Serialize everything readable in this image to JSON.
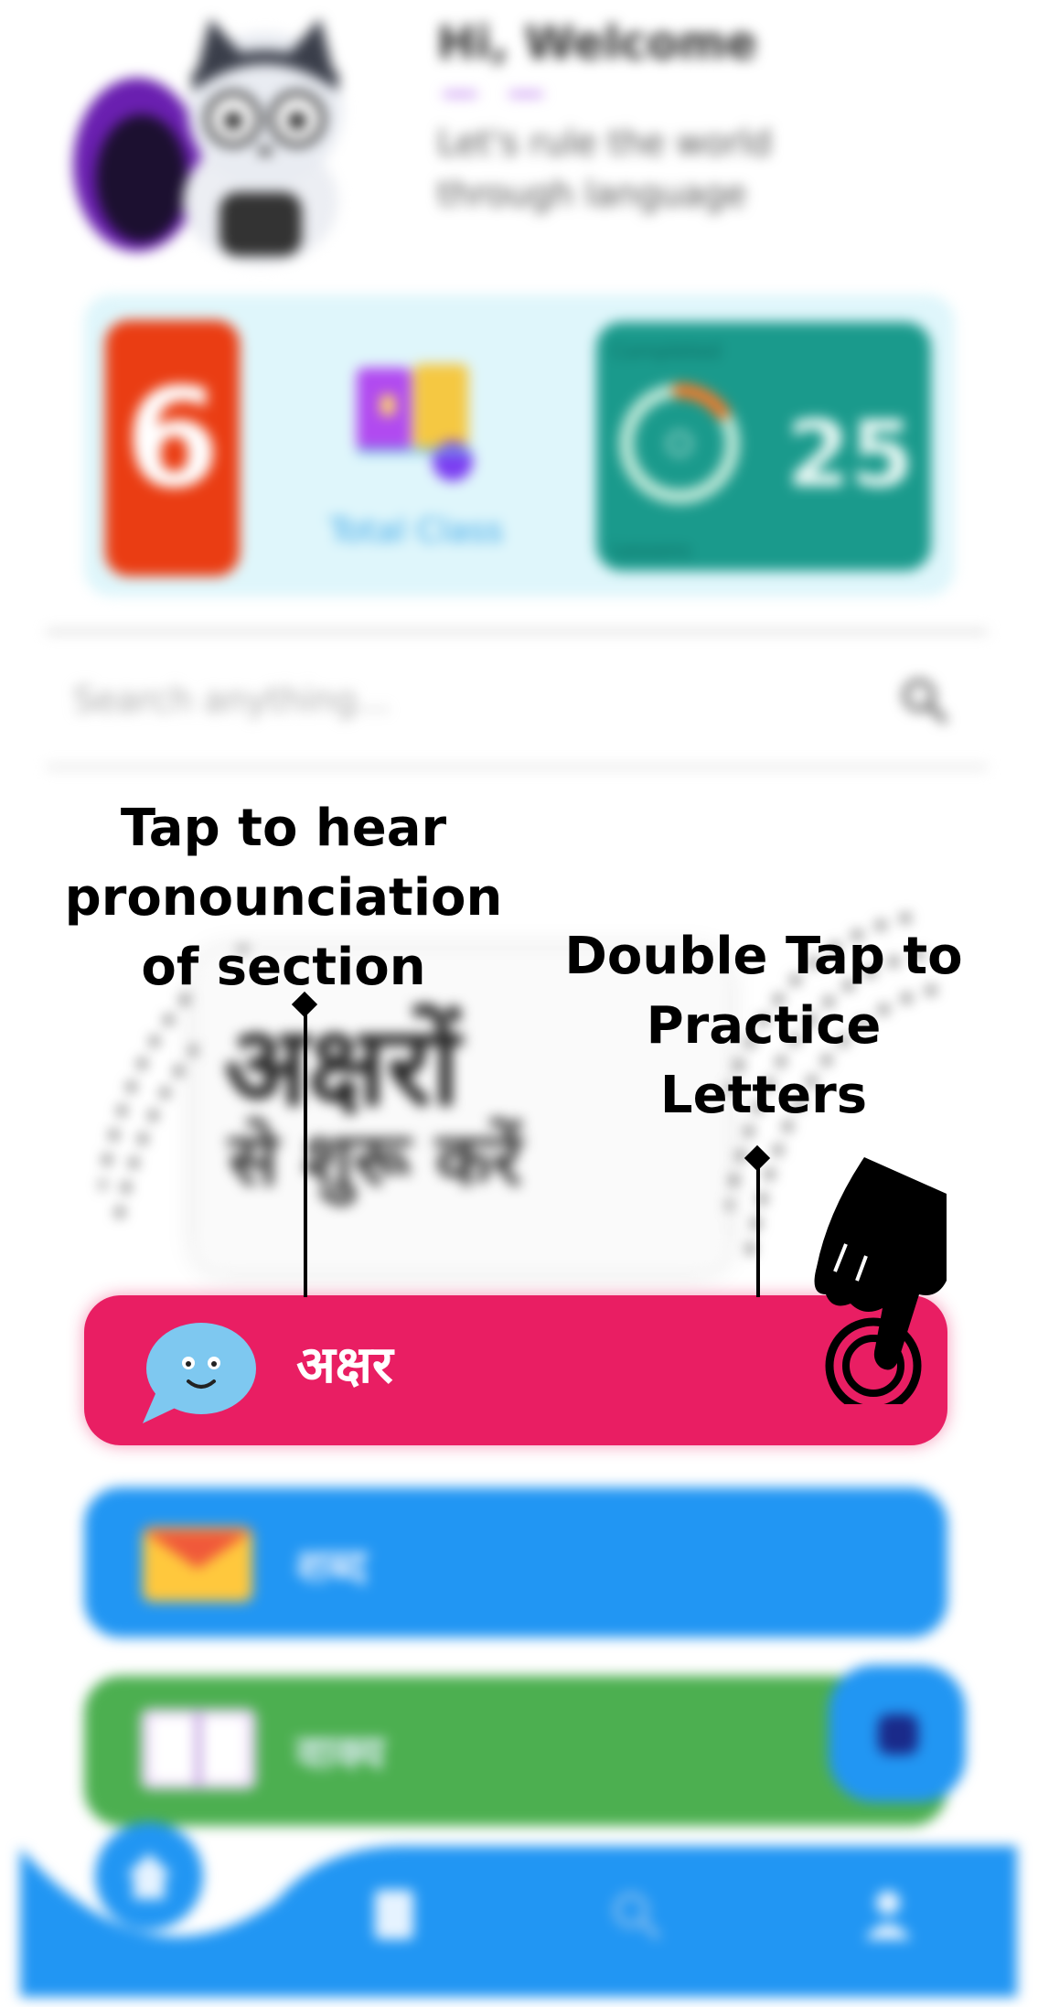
{
  "header": {
    "greeting": "Hi, Welcome",
    "tagline": "Let's rule the world through language"
  },
  "stats": {
    "streak_value": "6",
    "class_label": "Total Class",
    "progress_top_label": "Completed",
    "progress_value": "25",
    "progress_bottom_label": "Lessons",
    "progress_fraction": 0.15
  },
  "search": {
    "placeholder": "Search anything..."
  },
  "banner": {
    "line1": "अक्षरों",
    "line2": "से शुरू करें"
  },
  "sections": [
    {
      "label": "अक्षर",
      "color": "#e91e63"
    },
    {
      "label": "शब्द",
      "color": "#2196f3"
    },
    {
      "label": "वाक्य",
      "color": "#4caf50"
    }
  ],
  "callouts": {
    "left": "Tap to hear pronounciation of section",
    "right": "Double Tap to Practice Letters"
  },
  "icons": {
    "mascot": "cat-mascot-icon",
    "class": "books-icon",
    "search": "search-icon",
    "chat": "chat-bubble-icon",
    "tap": "double-tap-hand-icon",
    "mail": "mail-icon",
    "book": "open-book-icon",
    "home": "home-icon",
    "notes": "notes-icon",
    "nav_search": "search-icon",
    "profile": "profile-icon"
  },
  "colors": {
    "accent_pink": "#e91e63",
    "accent_blue": "#2196f3",
    "accent_green": "#4caf50",
    "streak_red": "#ea3d13",
    "teal": "#1a9a8c"
  }
}
